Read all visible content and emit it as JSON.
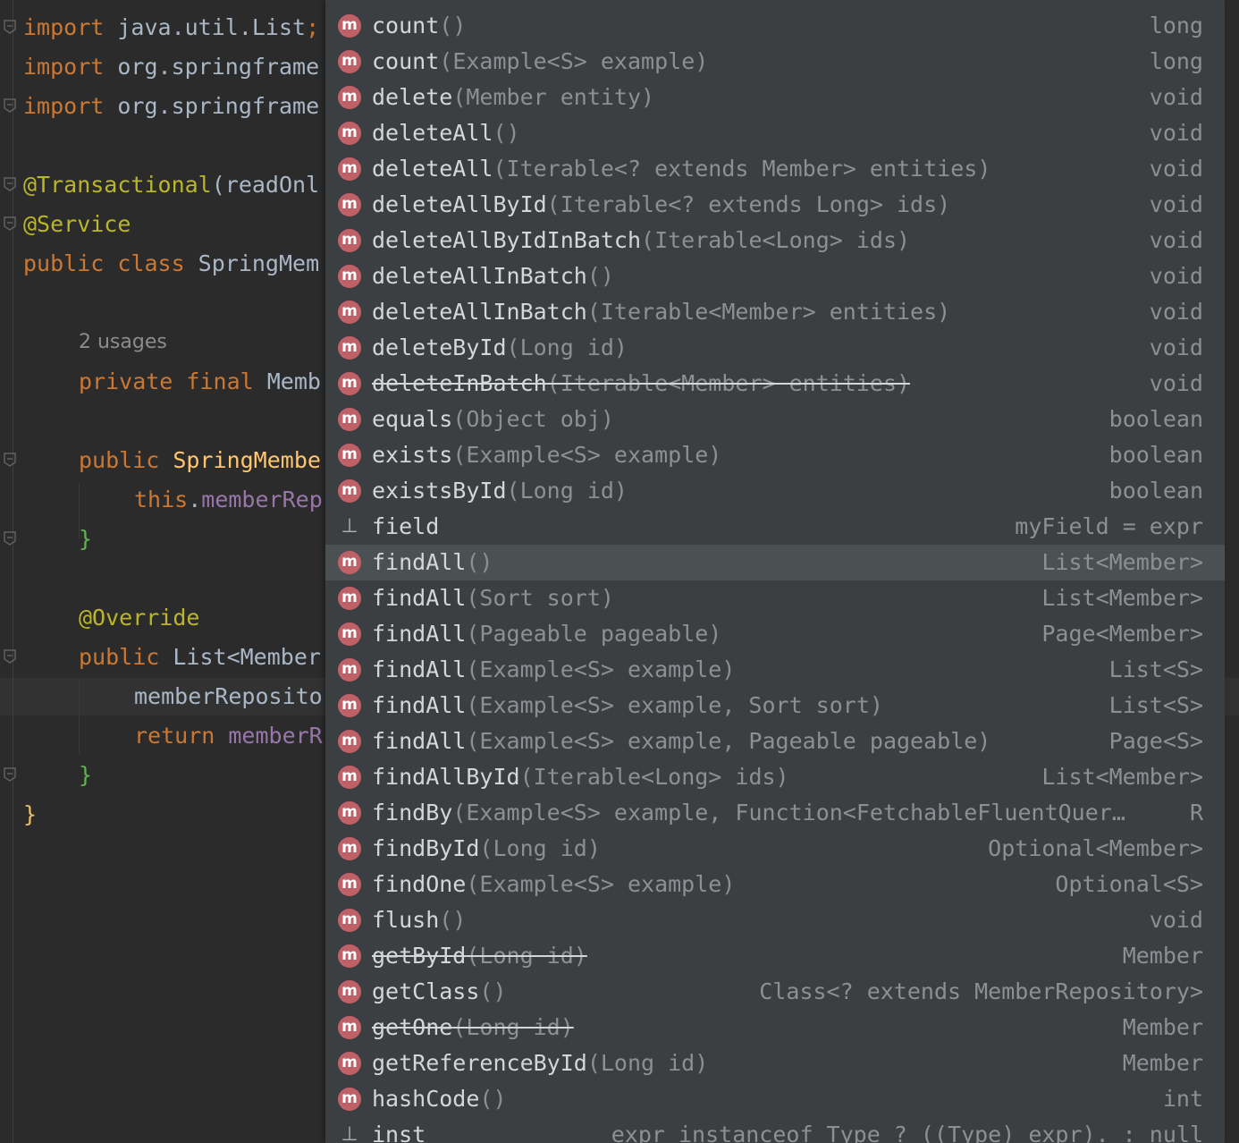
{
  "editor": {
    "lines": [
      {
        "segments": [
          {
            "t": "import",
            "c": "kw"
          },
          {
            "t": " java.util.List",
            "c": "plain"
          },
          {
            "t": ";",
            "c": "kw"
          }
        ]
      },
      {
        "segments": [
          {
            "t": "import",
            "c": "kw"
          },
          {
            "t": " org.springframe",
            "c": "plain"
          }
        ]
      },
      {
        "segments": [
          {
            "t": "import",
            "c": "kw"
          },
          {
            "t": " org.springframe",
            "c": "plain"
          }
        ]
      },
      {
        "segments": [
          {
            "t": "@Transactional",
            "c": "ann"
          },
          {
            "t": "(readOnl",
            "c": "plain"
          }
        ]
      },
      {
        "segments": [
          {
            "t": "@Service",
            "c": "ann"
          }
        ]
      },
      {
        "segments": [
          {
            "t": "public class",
            "c": "kw"
          },
          {
            "t": " SpringMem",
            "c": "plain"
          }
        ]
      },
      {
        "segments": [
          {
            "t": "private final",
            "c": "kw"
          },
          {
            "t": " Memb",
            "c": "plain"
          }
        ]
      },
      {
        "segments": [
          {
            "t": "public",
            "c": "kw"
          },
          {
            "t": " SpringMembe",
            "c": "fn"
          }
        ]
      },
      {
        "segments": [
          {
            "t": "this",
            "c": "kw"
          },
          {
            "t": ".",
            "c": "plain"
          },
          {
            "t": "memberRep",
            "c": "fld"
          }
        ]
      },
      {
        "segments": [
          {
            "t": "}",
            "c": "brace-g"
          }
        ]
      },
      {
        "segments": [
          {
            "t": "@Override",
            "c": "ann"
          }
        ]
      },
      {
        "segments": [
          {
            "t": "public",
            "c": "kw"
          },
          {
            "t": " List<Member",
            "c": "plain"
          }
        ]
      },
      {
        "segments": [
          {
            "t": "memberReposito",
            "c": "plain"
          }
        ]
      },
      {
        "segments": [
          {
            "t": "return",
            "c": "kw"
          },
          {
            "t": " memberR",
            "c": "fld"
          }
        ]
      },
      {
        "segments": [
          {
            "t": "}",
            "c": "brace-g"
          }
        ]
      },
      {
        "segments": [
          {
            "t": "}",
            "c": "brace-y"
          }
        ]
      }
    ],
    "usages_hint": "2 usages"
  },
  "completion": {
    "items": [
      {
        "icon": "m",
        "name": "count",
        "params": "()",
        "ret": "long",
        "deprecated": false
      },
      {
        "icon": "m",
        "name": "count",
        "params": "(Example<S> example)",
        "ret": "long",
        "deprecated": false
      },
      {
        "icon": "m",
        "name": "delete",
        "params": "(Member entity)",
        "ret": "void",
        "deprecated": false
      },
      {
        "icon": "m",
        "name": "deleteAll",
        "params": "()",
        "ret": "void",
        "deprecated": false
      },
      {
        "icon": "m",
        "name": "deleteAll",
        "params": "(Iterable<? extends Member> entities)",
        "ret": "void",
        "deprecated": false
      },
      {
        "icon": "m",
        "name": "deleteAllById",
        "params": "(Iterable<? extends Long> ids)",
        "ret": "void",
        "deprecated": false
      },
      {
        "icon": "m",
        "name": "deleteAllByIdInBatch",
        "params": "(Iterable<Long> ids)",
        "ret": "void",
        "deprecated": false
      },
      {
        "icon": "m",
        "name": "deleteAllInBatch",
        "params": "()",
        "ret": "void",
        "deprecated": false
      },
      {
        "icon": "m",
        "name": "deleteAllInBatch",
        "params": "(Iterable<Member> entities)",
        "ret": "void",
        "deprecated": false
      },
      {
        "icon": "m",
        "name": "deleteById",
        "params": "(Long id)",
        "ret": "void",
        "deprecated": false
      },
      {
        "icon": "m",
        "name": "deleteInBatch",
        "params": "(Iterable<Member> entities)",
        "ret": "void",
        "deprecated": true
      },
      {
        "icon": "m",
        "name": "equals",
        "params": "(Object obj)",
        "ret": "boolean",
        "deprecated": false
      },
      {
        "icon": "m",
        "name": "exists",
        "params": "(Example<S> example)",
        "ret": "boolean",
        "deprecated": false
      },
      {
        "icon": "m",
        "name": "existsById",
        "params": "(Long id)",
        "ret": "boolean",
        "deprecated": false
      },
      {
        "icon": "template",
        "name": "field",
        "params": "",
        "ret": "myField = expr",
        "deprecated": false
      },
      {
        "icon": "m",
        "name": "findAll",
        "params": "()",
        "ret": "List<Member>",
        "deprecated": false,
        "selected": true
      },
      {
        "icon": "m",
        "name": "findAll",
        "params": "(Sort sort)",
        "ret": "List<Member>",
        "deprecated": false
      },
      {
        "icon": "m",
        "name": "findAll",
        "params": "(Pageable pageable)",
        "ret": "Page<Member>",
        "deprecated": false
      },
      {
        "icon": "m",
        "name": "findAll",
        "params": "(Example<S> example)",
        "ret": "List<S>",
        "deprecated": false
      },
      {
        "icon": "m",
        "name": "findAll",
        "params": "(Example<S> example, Sort sort)",
        "ret": "List<S>",
        "deprecated": false
      },
      {
        "icon": "m",
        "name": "findAll",
        "params": "(Example<S> example, Pageable pageable)",
        "ret": "Page<S>",
        "deprecated": false
      },
      {
        "icon": "m",
        "name": "findAllById",
        "params": "(Iterable<Long> ids)",
        "ret": "List<Member>",
        "deprecated": false
      },
      {
        "icon": "m",
        "name": "findBy",
        "params": "(Example<S> example, Function<FetchableFluentQuer…",
        "ret": "R",
        "deprecated": false
      },
      {
        "icon": "m",
        "name": "findById",
        "params": "(Long id)",
        "ret": "Optional<Member>",
        "deprecated": false
      },
      {
        "icon": "m",
        "name": "findOne",
        "params": "(Example<S> example)",
        "ret": "Optional<S>",
        "deprecated": false
      },
      {
        "icon": "m",
        "name": "flush",
        "params": "()",
        "ret": "void",
        "deprecated": false
      },
      {
        "icon": "m",
        "name": "getById",
        "params": "(Long id)",
        "ret": "Member",
        "deprecated": true
      },
      {
        "icon": "m",
        "name": "getClass",
        "params": "()",
        "ret": "Class<? extends MemberRepository>",
        "deprecated": false
      },
      {
        "icon": "m",
        "name": "getOne",
        "params": "(Long id)",
        "ret": "Member",
        "deprecated": true
      },
      {
        "icon": "m",
        "name": "getReferenceById",
        "params": "(Long id)",
        "ret": "Member",
        "deprecated": false
      },
      {
        "icon": "m",
        "name": "hashCode",
        "params": "()",
        "ret": "int",
        "deprecated": false
      },
      {
        "icon": "template",
        "name": "inst",
        "params": "",
        "ret": "expr instanceof Type ? ((Type) expr). : null",
        "deprecated": false
      }
    ]
  }
}
